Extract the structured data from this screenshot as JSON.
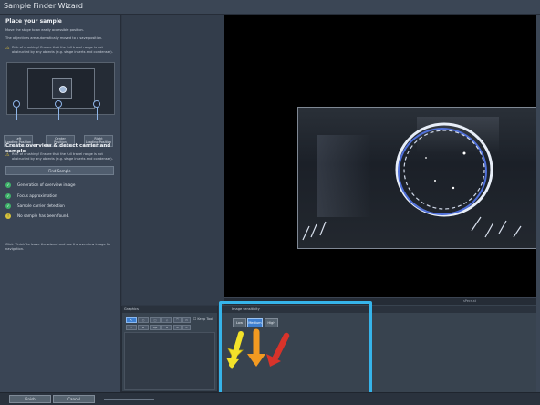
{
  "window": {
    "title": "Sample Finder Wizard"
  },
  "wizard": {
    "place": {
      "heading": "Place your sample",
      "line1": "Move the stage to an easily accessible position.",
      "line2": "The objectives are automatically moved to a save position.",
      "warning": "Risk of crushing! Ensure that the full travel range is not obstructed by any objects (e.g. stage inserts and condenser).",
      "positions": [
        {
          "label": "Left\nLoading Position"
        },
        {
          "label": "Center\nPosition"
        },
        {
          "label": "Right\nLoading Position"
        }
      ]
    },
    "overview": {
      "heading": "Create overview & detect carrier and sample",
      "warning": "Risk of crushing! Ensure that the full travel range is not obstructed by any objects (e.g. stage inserts and condenser).",
      "find_button": "Find Sample",
      "steps": [
        {
          "label": "Generation of overview image",
          "status": "done"
        },
        {
          "label": "Focus approximation",
          "status": "done"
        },
        {
          "label": "Sample carrier detection",
          "status": "done"
        },
        {
          "label": "No sample has been found.",
          "status": "warning"
        }
      ],
      "hint": "Click 'Finish' to leave the wizard and use the overview image for navigation."
    }
  },
  "viewer": {
    "status_text": "sPecs.st"
  },
  "graphics_panel": {
    "title": "Graphics",
    "keep_tool_label": "Keep Tool",
    "tool_row1": [
      "↖",
      "○",
      "□",
      "◇",
      "⌒",
      "▭"
    ],
    "tool_row2": [
      "T",
      "⊿",
      "Spl",
      "A",
      "B",
      "C"
    ]
  },
  "sensitivity_panel": {
    "title": "Image sensitivity",
    "options": [
      {
        "label": "Low",
        "selected": false
      },
      {
        "label": "Medium",
        "selected": true
      },
      {
        "label": "High",
        "selected": false
      }
    ]
  },
  "footer": {
    "finish_label": "Finish",
    "cancel_label": "Cancel"
  },
  "colors": {
    "highlight": "#36b4ea",
    "arrow_low": "#f3e22a",
    "arrow_medium": "#f39a21",
    "arrow_high": "#d8332a"
  }
}
